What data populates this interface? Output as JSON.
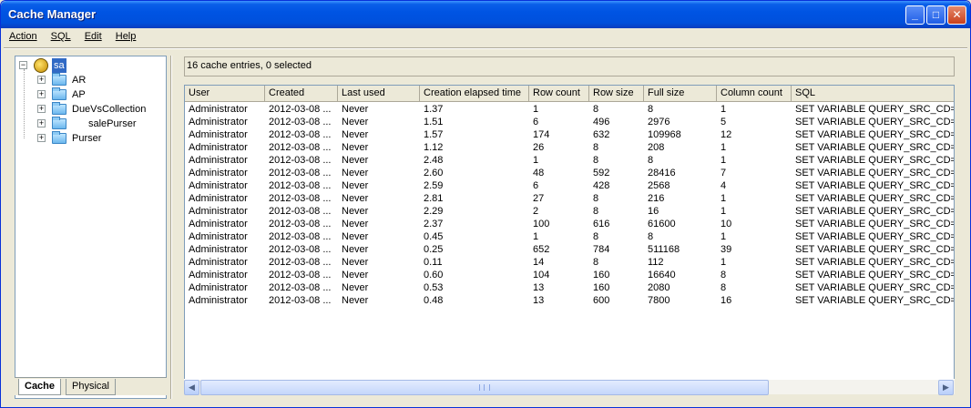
{
  "window": {
    "title": "Cache Manager"
  },
  "menu": [
    {
      "label": "Action"
    },
    {
      "label": "SQL"
    },
    {
      "label": "Edit"
    },
    {
      "label": "Help"
    }
  ],
  "tree": {
    "root": "sa",
    "items": [
      {
        "label": "AR"
      },
      {
        "label": "AP"
      },
      {
        "label": "DueVsCollection"
      },
      {
        "label": "salePurser"
      },
      {
        "label": "Purser"
      }
    ]
  },
  "tabs": {
    "cache": "Cache",
    "physical": "Physical"
  },
  "status": "16 cache entries, 0 selected",
  "table": {
    "columns": [
      "User",
      "Created",
      "Last used",
      "Creation elapsed time",
      "Row count",
      "Row size",
      "Full size",
      "Column count",
      "SQL"
    ],
    "rows": [
      [
        "Administrator",
        "2012-03-08 ...",
        "Never",
        "1.37",
        "1",
        "8",
        "8",
        "1",
        "SET VARIABLE QUERY_SRC_CD="
      ],
      [
        "Administrator",
        "2012-03-08 ...",
        "Never",
        "1.51",
        "6",
        "496",
        "2976",
        "5",
        "SET VARIABLE QUERY_SRC_CD="
      ],
      [
        "Administrator",
        "2012-03-08 ...",
        "Never",
        "1.57",
        "174",
        "632",
        "109968",
        "12",
        "SET VARIABLE QUERY_SRC_CD="
      ],
      [
        "Administrator",
        "2012-03-08 ...",
        "Never",
        "1.12",
        "26",
        "8",
        "208",
        "1",
        "SET VARIABLE QUERY_SRC_CD="
      ],
      [
        "Administrator",
        "2012-03-08 ...",
        "Never",
        "2.48",
        "1",
        "8",
        "8",
        "1",
        "SET VARIABLE QUERY_SRC_CD="
      ],
      [
        "Administrator",
        "2012-03-08 ...",
        "Never",
        "2.60",
        "48",
        "592",
        "28416",
        "7",
        "SET VARIABLE QUERY_SRC_CD="
      ],
      [
        "Administrator",
        "2012-03-08 ...",
        "Never",
        "2.59",
        "6",
        "428",
        "2568",
        "4",
        "SET VARIABLE QUERY_SRC_CD="
      ],
      [
        "Administrator",
        "2012-03-08 ...",
        "Never",
        "2.81",
        "27",
        "8",
        "216",
        "1",
        "SET VARIABLE QUERY_SRC_CD="
      ],
      [
        "Administrator",
        "2012-03-08 ...",
        "Never",
        "2.29",
        "2",
        "8",
        "16",
        "1",
        "SET VARIABLE QUERY_SRC_CD="
      ],
      [
        "Administrator",
        "2012-03-08 ...",
        "Never",
        "2.37",
        "100",
        "616",
        "61600",
        "10",
        "SET VARIABLE QUERY_SRC_CD="
      ],
      [
        "Administrator",
        "2012-03-08 ...",
        "Never",
        "0.45",
        "1",
        "8",
        "8",
        "1",
        "SET VARIABLE QUERY_SRC_CD="
      ],
      [
        "Administrator",
        "2012-03-08 ...",
        "Never",
        "0.25",
        "652",
        "784",
        "511168",
        "39",
        "SET VARIABLE QUERY_SRC_CD="
      ],
      [
        "Administrator",
        "2012-03-08 ...",
        "Never",
        "0.11",
        "14",
        "8",
        "112",
        "1",
        "SET VARIABLE QUERY_SRC_CD="
      ],
      [
        "Administrator",
        "2012-03-08 ...",
        "Never",
        "0.60",
        "104",
        "160",
        "16640",
        "8",
        "SET VARIABLE QUERY_SRC_CD="
      ],
      [
        "Administrator",
        "2012-03-08 ...",
        "Never",
        "0.53",
        "13",
        "160",
        "2080",
        "8",
        "SET VARIABLE QUERY_SRC_CD="
      ],
      [
        "Administrator",
        "2012-03-08 ...",
        "Never",
        "0.48",
        "13",
        "600",
        "7800",
        "16",
        "SET VARIABLE QUERY_SRC_CD="
      ]
    ]
  },
  "icons": {
    "minimize": "minimize-icon",
    "maximize": "maximize-icon",
    "close": "close-icon",
    "folder": "folder-icon",
    "scroll_left": "arrow-left-icon",
    "scroll_right": "arrow-right-icon"
  }
}
